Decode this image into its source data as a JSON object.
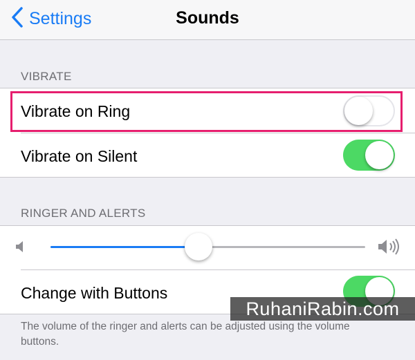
{
  "navbar": {
    "back_label": "Settings",
    "title": "Sounds",
    "back_icon": "chevron-left-icon"
  },
  "vibrate": {
    "header": "VIBRATE",
    "items": [
      {
        "label": "Vibrate on Ring",
        "toggle": "off"
      },
      {
        "label": "Vibrate on Silent",
        "toggle": "on"
      }
    ]
  },
  "ringer": {
    "header": "RINGER AND ALERTS",
    "volume_level": 0.47,
    "volume_low_icon": "speaker-low-icon",
    "volume_high_icon": "speaker-high-icon",
    "change_with_buttons": {
      "label": "Change with Buttons",
      "toggle": "on"
    },
    "footer": "The volume of the ringer and alerts can be adjusted using the volume buttons."
  },
  "watermark": "RuhaniRabin.com",
  "colors": {
    "accent": "#1a7cf5",
    "toggle_on": "#4cd964",
    "highlight": "#e61e6e",
    "background": "#efeff4"
  }
}
